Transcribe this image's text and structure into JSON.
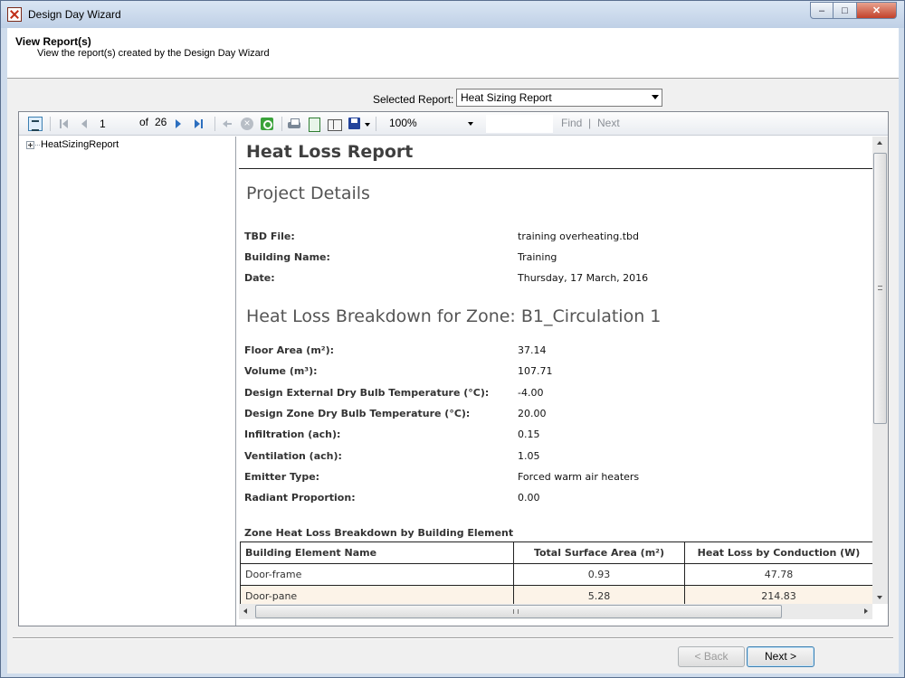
{
  "window": {
    "title": "Design Day Wizard",
    "minimize": "–",
    "maximize": "□",
    "close": "✕"
  },
  "header": {
    "title": "View Report(s)",
    "subtitle": "View the report(s) created by the Design Day Wizard"
  },
  "report_selector": {
    "label": "Selected Report:",
    "value": "Heat Sizing Report"
  },
  "toolbar": {
    "page_current": "1",
    "page_of": "of",
    "page_total": "26",
    "zoom": "100%",
    "find_label": "Find",
    "find_sep": "|",
    "next_label": "Next"
  },
  "tree": {
    "root_label": "HeatSizingReport"
  },
  "report": {
    "title": "Heat Loss Report",
    "project_heading": "Project Details",
    "project_fields": [
      {
        "label": "TBD File:",
        "value": "training overheating.tbd"
      },
      {
        "label": "Building Name:",
        "value": "Training"
      },
      {
        "label": "Date:",
        "value": "Thursday, 17 March, 2016"
      }
    ],
    "zone_heading": "Heat Loss Breakdown for Zone: B1_Circulation 1",
    "zone_fields": [
      {
        "label": "Floor Area (m²):",
        "value": "37.14"
      },
      {
        "label": "Volume (m³):",
        "value": "107.71"
      },
      {
        "label": "Design External Dry Bulb Temperature (°C):",
        "value": "-4.00"
      },
      {
        "label": "Design Zone Dry Bulb Temperature (°C):",
        "value": "20.00"
      },
      {
        "label": "Infiltration (ach):",
        "value": "0.15"
      },
      {
        "label": "Ventilation (ach):",
        "value": "1.05"
      },
      {
        "label": "Emitter Type:",
        "value": "Forced warm air heaters"
      },
      {
        "label": "Radiant Proportion:",
        "value": "0.00"
      }
    ],
    "table_title": "Zone Heat Loss Breakdown by Building Element",
    "table_headers": [
      "Building Element Name",
      "Total Surface Area (m²)",
      "Heat Loss by Conduction (W)"
    ],
    "table_rows": [
      [
        "Door-frame",
        "0.93",
        "47.78"
      ],
      [
        "Door-pane",
        "5.28",
        "214.83"
      ]
    ]
  },
  "buttons": {
    "back": "< Back",
    "next": "Next >"
  }
}
